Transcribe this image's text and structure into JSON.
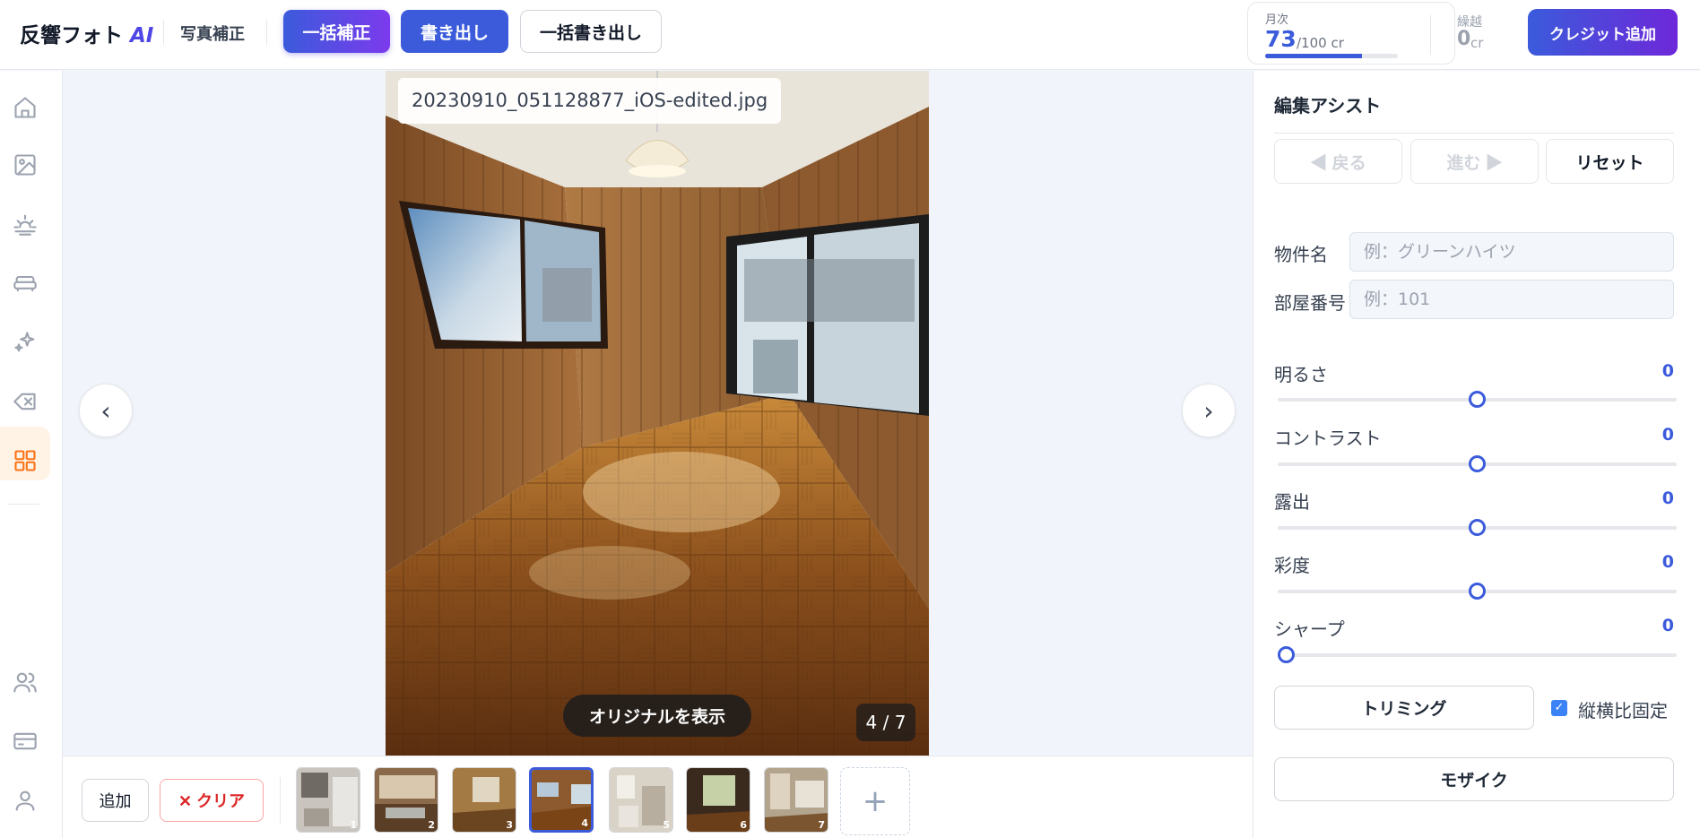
{
  "header": {
    "brand": "反響フォト",
    "brand_ai": "AI",
    "breadcrumb": "写真補正",
    "batch_correct_label": "一括補正",
    "export_label": "書き出し",
    "batch_export_label": "一括書き出し",
    "credits": {
      "monthly_label": "月次",
      "monthly_value": "73",
      "monthly_unit": "/100 cr",
      "monthly_fraction": 0.73,
      "carryover_label": "繰越",
      "carryover_value": "0",
      "carryover_unit": "cr"
    },
    "add_credit_label": "クレジット追加"
  },
  "sidebar": {
    "items": [
      {
        "name": "home-icon"
      },
      {
        "name": "image-icon"
      },
      {
        "name": "sunrise-icon"
      },
      {
        "name": "sofa-icon"
      },
      {
        "name": "sparkle-icon"
      },
      {
        "name": "eraser-icon"
      },
      {
        "name": "grid-icon",
        "active": true
      },
      {
        "name": "users-icon"
      },
      {
        "name": "credit-card-icon"
      },
      {
        "name": "user-icon"
      }
    ]
  },
  "viewer": {
    "filename": "20230910_051128877_iOS-edited.jpg",
    "prev_label": "‹",
    "next_label": "›",
    "show_original_label": "オリジナルを表示",
    "counter": "4 / 7"
  },
  "filmstrip": {
    "add_label": "追加",
    "clear_label": "✕ クリア",
    "thumbnails": [
      "1",
      "2",
      "3",
      "4",
      "5",
      "6",
      "7"
    ],
    "selected_index": 4,
    "add_more_label": "+"
  },
  "panel": {
    "title": "編集アシスト",
    "back_label": "◀ 戻る",
    "forward_label": "進む ▶",
    "reset_label": "リセット",
    "property_name_label": "物件名",
    "property_name_placeholder": "例：グリーンハイツ",
    "room_number_label": "部屋番号",
    "room_number_placeholder": "例：101",
    "sliders": [
      {
        "label": "明るさ",
        "value": "0",
        "level": 0.5
      },
      {
        "label": "コントラスト",
        "value": "0",
        "level": 0.5
      },
      {
        "label": "露出",
        "value": "0",
        "level": 0.5
      },
      {
        "label": "彩度",
        "value": "0",
        "level": 0.5
      },
      {
        "label": "シャープ",
        "value": "0",
        "level": 0.0
      }
    ],
    "trim_label": "トリミング",
    "aspect_lock_label": "縦横比固定",
    "aspect_lock_checked": true,
    "mosaic_label": "モザイク"
  },
  "colors": {
    "accent": "#3b5bdb",
    "active_nav": "#f97316"
  }
}
